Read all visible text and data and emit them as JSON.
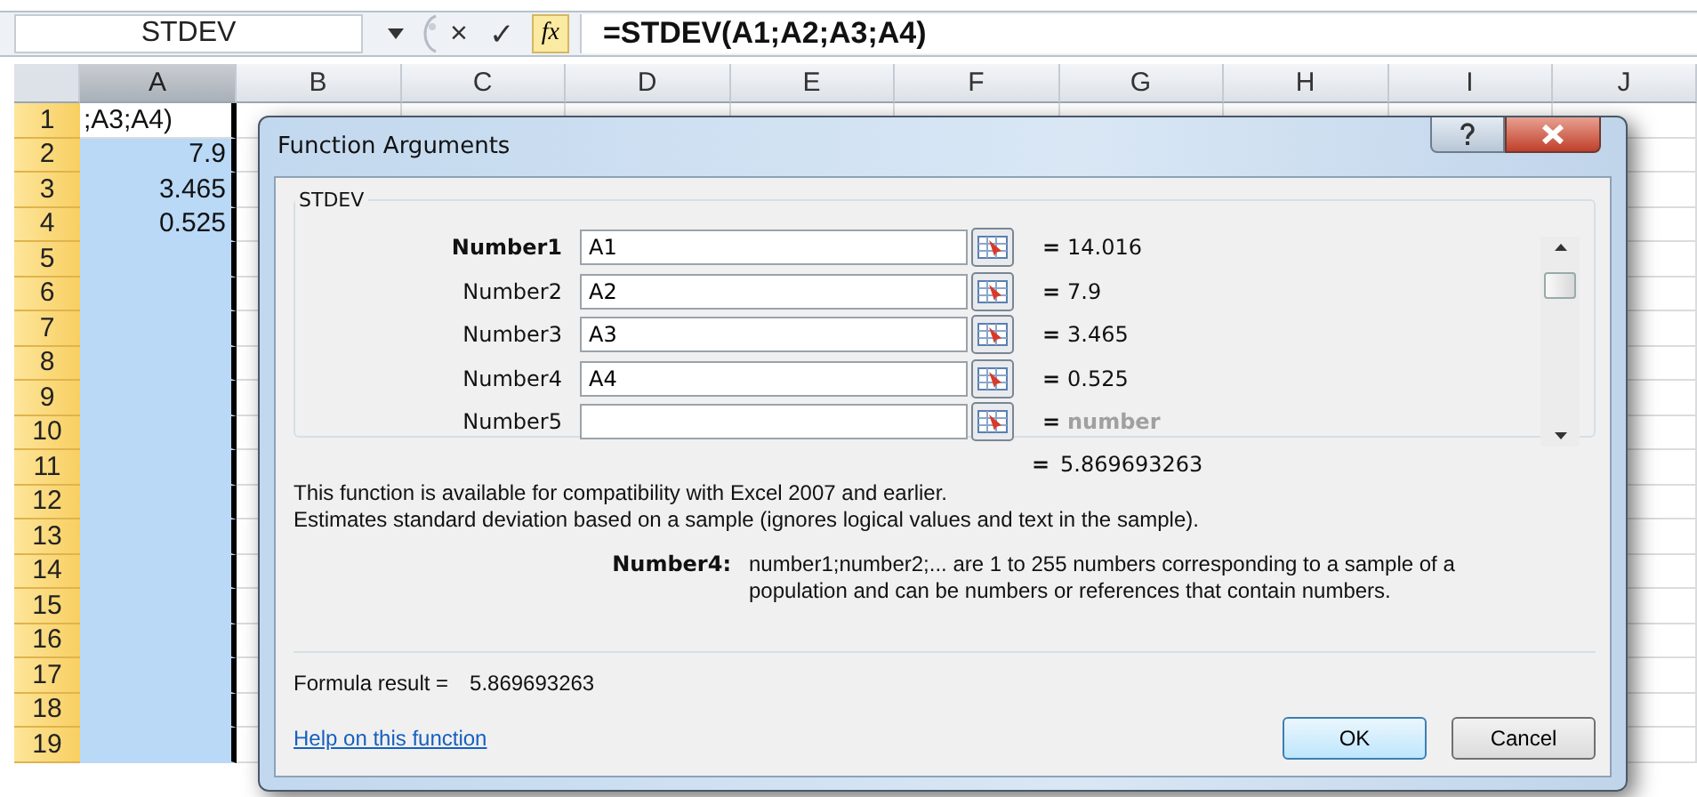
{
  "formula_bar": {
    "name_box": "STDEV",
    "cancel": "×",
    "enter": "✓",
    "function": "fx",
    "formula": "=STDEV(A1;A2;A3;A4)"
  },
  "sheet": {
    "columns": [
      {
        "label": "A",
        "selected": true
      },
      {
        "label": "B",
        "selected": false
      },
      {
        "label": "C",
        "selected": false
      },
      {
        "label": "D",
        "selected": false
      },
      {
        "label": "E",
        "selected": false
      },
      {
        "label": "F",
        "selected": false
      },
      {
        "label": "G",
        "selected": false
      },
      {
        "label": "H",
        "selected": false
      },
      {
        "label": "I",
        "selected": false
      },
      {
        "label": "J",
        "selected": false
      }
    ],
    "rows": [
      {
        "label": "1",
        "a": ";A3;A4)",
        "selected": false
      },
      {
        "label": "2",
        "a": "7.9",
        "selected": true
      },
      {
        "label": "3",
        "a": "3.465",
        "selected": true
      },
      {
        "label": "4",
        "a": "0.525",
        "selected": true
      },
      {
        "label": "5",
        "selected": true
      },
      {
        "label": "6",
        "selected": true
      },
      {
        "label": "7",
        "selected": true
      },
      {
        "label": "8",
        "selected": true
      },
      {
        "label": "9",
        "selected": true
      },
      {
        "label": "10",
        "selected": true
      },
      {
        "label": "11",
        "selected": true
      },
      {
        "label": "12",
        "selected": true
      },
      {
        "label": "13",
        "selected": true
      },
      {
        "label": "14",
        "selected": true
      },
      {
        "label": "15",
        "selected": true
      },
      {
        "label": "16",
        "selected": true
      },
      {
        "label": "17",
        "selected": true
      },
      {
        "label": "18",
        "selected": true
      },
      {
        "label": "19",
        "selected": true
      }
    ]
  },
  "dialog": {
    "title": "Function Arguments",
    "group_title": "STDEV",
    "arguments": [
      {
        "label": "Number1",
        "required": true,
        "value": "A1",
        "equals": "=",
        "result": "14.016",
        "dimmed": false
      },
      {
        "label": "Number2",
        "required": false,
        "value": "A2",
        "equals": "=",
        "result": "7.9",
        "dimmed": false
      },
      {
        "label": "Number3",
        "required": false,
        "value": "A3",
        "equals": "=",
        "result": "3.465",
        "dimmed": false
      },
      {
        "label": "Number4",
        "required": false,
        "value": "A4",
        "equals": "=",
        "result": "0.525",
        "dimmed": false
      },
      {
        "label": "Number5",
        "required": false,
        "equals": "=",
        "result": "number",
        "dimmed": true
      }
    ],
    "total": {
      "equals": "=",
      "value": "5.869693263"
    },
    "description": [
      "This function is available for compatibility with Excel 2007 and earlier.",
      "Estimates standard deviation based on a sample (ignores logical values and text in the sample)."
    ],
    "argument_help": {
      "label": "Number4:",
      "text": "number1;number2;... are 1 to 255 numbers corresponding to a sample of a population and can be numbers or references that contain numbers."
    },
    "formula_result": {
      "label": "Formula result =",
      "value": "5.869693263"
    },
    "help_link": "Help on this function",
    "buttons": [
      {
        "label": "OK",
        "default": true
      },
      {
        "label": "Cancel",
        "default": false
      }
    ]
  }
}
